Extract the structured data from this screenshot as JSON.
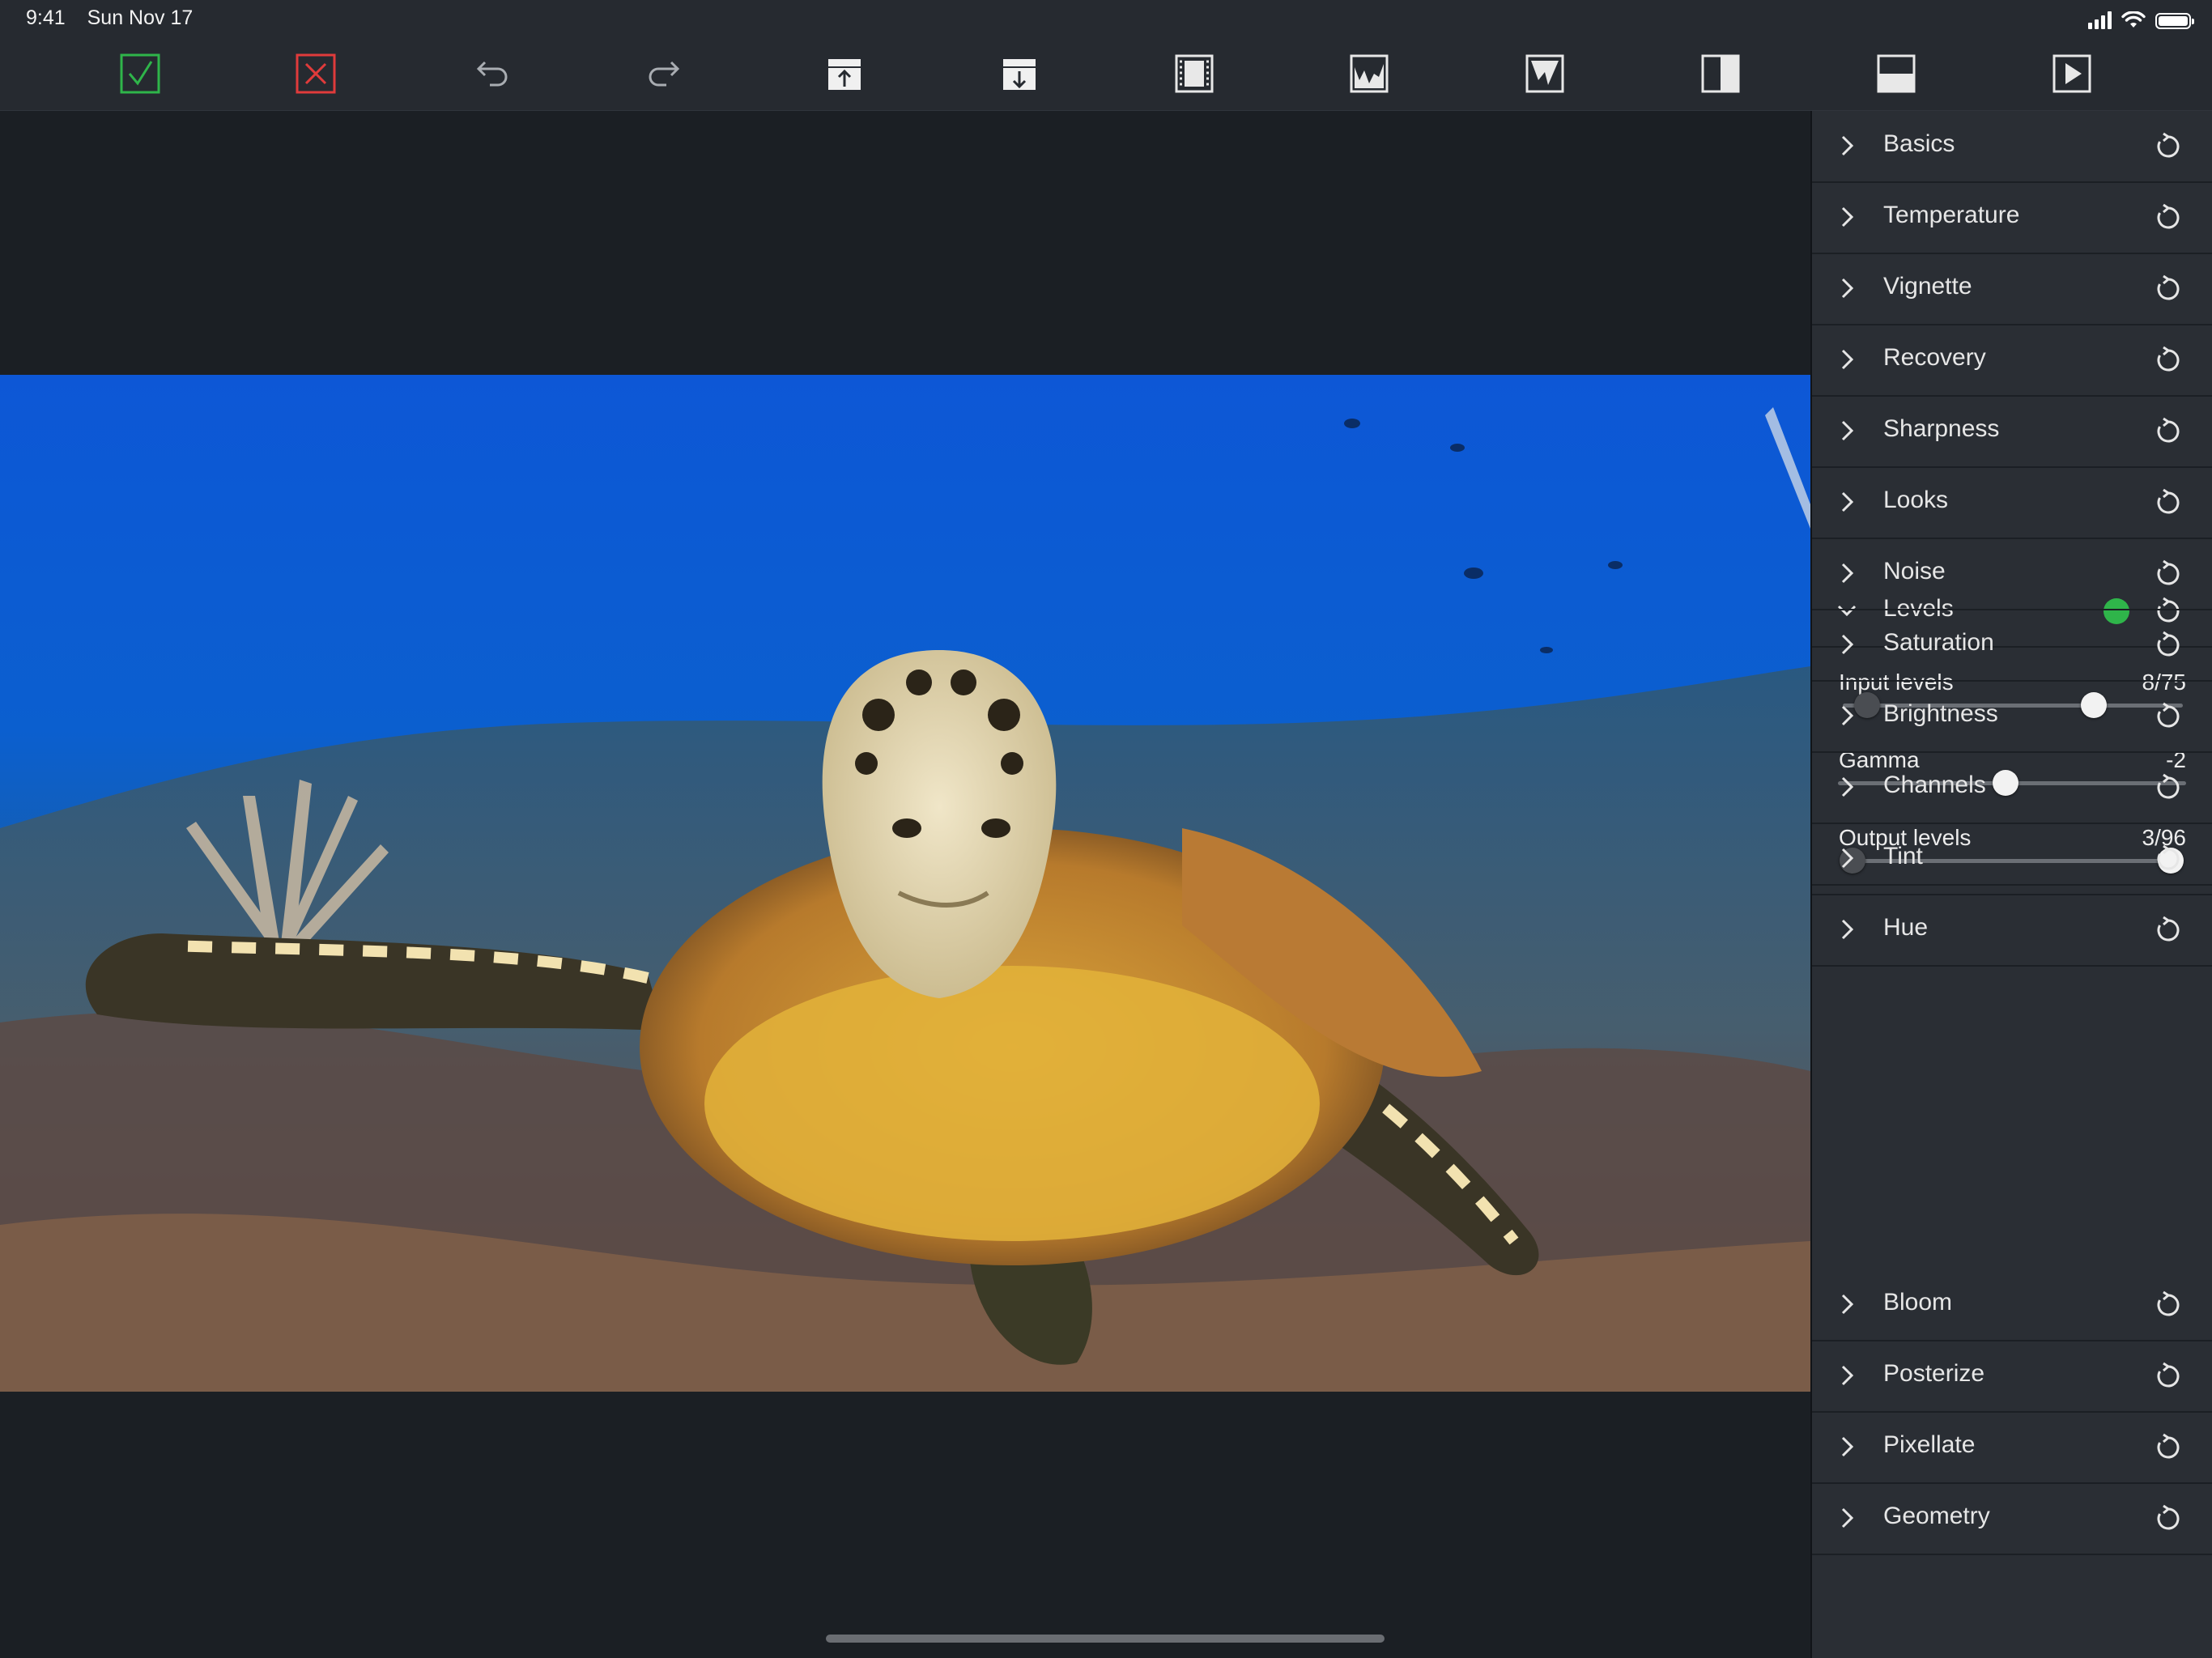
{
  "status_bar": {
    "time": "9:41",
    "date": "Sun Nov 17"
  },
  "toolbar": {
    "buttons": [
      {
        "icon": "checkmark-icon",
        "color": "#2fb54a"
      },
      {
        "icon": "close-icon",
        "color": "#e03b3b"
      },
      {
        "icon": "undo-icon"
      },
      {
        "icon": "redo-icon"
      },
      {
        "icon": "export-icon"
      },
      {
        "icon": "import-icon"
      },
      {
        "icon": "filmstrip-icon"
      },
      {
        "icon": "histogram-icon"
      },
      {
        "icon": "waveform-icon"
      },
      {
        "icon": "split-vertical-icon"
      },
      {
        "icon": "split-horizontal-icon"
      },
      {
        "icon": "play-icon"
      }
    ]
  },
  "panel": {
    "rows_top": [
      "Basics",
      "Temperature",
      "Vignette",
      "Recovery",
      "Sharpness",
      "Looks",
      "Noise",
      "Saturation",
      "Brightness",
      "Channels",
      "Tint",
      "Hue"
    ],
    "levels": {
      "title": "Levels",
      "active_color": "#2fb54a",
      "input_levels": {
        "label": "Input levels",
        "value": "8/75"
      },
      "gamma": {
        "label": "Gamma",
        "value": "-2"
      },
      "output_levels": {
        "label": "Output levels",
        "value": "3/96"
      }
    },
    "rows_bottom": [
      "Bloom",
      "Posterize",
      "Pixellate",
      "Geometry"
    ]
  }
}
